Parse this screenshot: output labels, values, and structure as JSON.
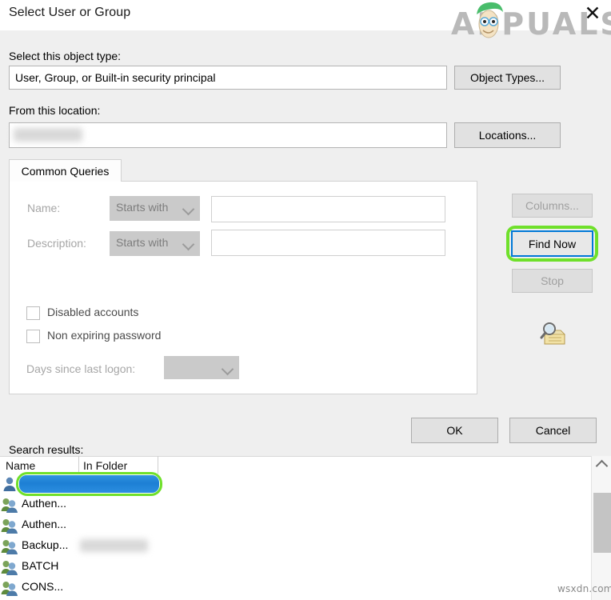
{
  "window": {
    "title": "Select User or Group",
    "close_label": "✕"
  },
  "watermark": {
    "brand": "APPUALS",
    "bottom": "wsxdn.com"
  },
  "object_type": {
    "label": "Select this object type:",
    "value": "User, Group, or Built-in security principal",
    "button": "Object Types..."
  },
  "location": {
    "label": "From this location:",
    "value": "",
    "button": "Locations..."
  },
  "tab": {
    "label": "Common Queries"
  },
  "queries": {
    "name_label": "Name:",
    "name_operator": "Starts with",
    "name_value": "",
    "description_label": "Description:",
    "description_operator": "Starts with",
    "description_value": "",
    "disabled_accounts_label": "Disabled accounts",
    "non_expiring_label": "Non expiring password",
    "days_label": "Days since last logon:",
    "days_value": ""
  },
  "actions": {
    "columns": "Columns...",
    "find_now": "Find Now",
    "stop": "Stop"
  },
  "footer": {
    "ok": "OK",
    "cancel": "Cancel"
  },
  "results": {
    "label": "Search results:",
    "columns": [
      "Name",
      "In Folder"
    ],
    "rows": [
      {
        "name": "",
        "folder": "",
        "selected": true,
        "icon": "user"
      },
      {
        "name": "Authen...",
        "folder": "",
        "selected": false,
        "icon": "group"
      },
      {
        "name": "Authen...",
        "folder": "",
        "selected": false,
        "icon": "group"
      },
      {
        "name": "Backup...",
        "folder": "",
        "selected": false,
        "icon": "group"
      },
      {
        "name": "BATCH",
        "folder": "",
        "selected": false,
        "icon": "group"
      },
      {
        "name": "CONS...",
        "folder": "",
        "selected": false,
        "icon": "group"
      }
    ]
  },
  "colors": {
    "accent_focus": "#0078d7",
    "highlight_ring": "#6fe02a",
    "selection_blue": "#1d7fd4",
    "dialog_bg": "#efefef"
  }
}
